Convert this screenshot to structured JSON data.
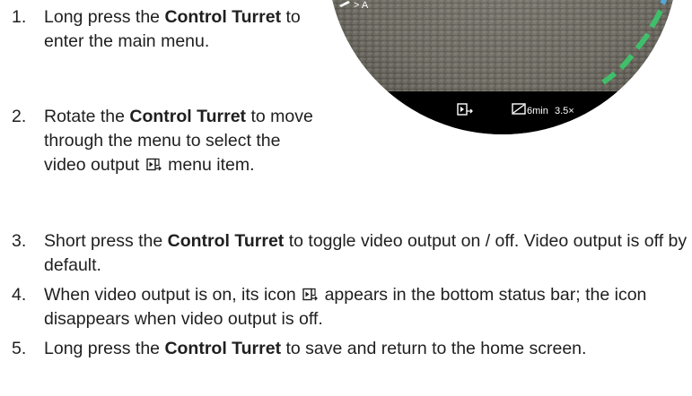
{
  "steps": [
    {
      "number": "1.",
      "before": "Long press the ",
      "bold": "Control Turret",
      "after": " to enter the main menu."
    },
    {
      "number": "2.",
      "before": "Rotate the ",
      "bold": "Control Turret",
      "after": " to move through the menu to select the video output ",
      "after_icon": " menu item.",
      "icon": "video-output-icon"
    },
    {
      "number": "3.",
      "before": "Short press the ",
      "bold": "Control Turret",
      "after": " to toggle video output on / off. Video output is off by default."
    },
    {
      "number": "4.",
      "before": "When video output is on, its icon ",
      "icon": "video-output-icon",
      "after": " appears in the bottom status bar; the icon disappears when video output is off."
    },
    {
      "number": "5.",
      "before": "Long press the ",
      "bold": "Control Turret",
      "after": " to save and return to the home screen."
    }
  ],
  "scope_view": {
    "top_left_indicator": "> A",
    "status_bar": {
      "icons": [
        "video-output-icon",
        "recording-icon"
      ],
      "recording_time": "6min",
      "zoom": "3.5×"
    },
    "colors": {
      "ring_green": "#3fbf6a",
      "ring_blue": "#56a8d6",
      "status_bar_bg": "#000000"
    }
  }
}
